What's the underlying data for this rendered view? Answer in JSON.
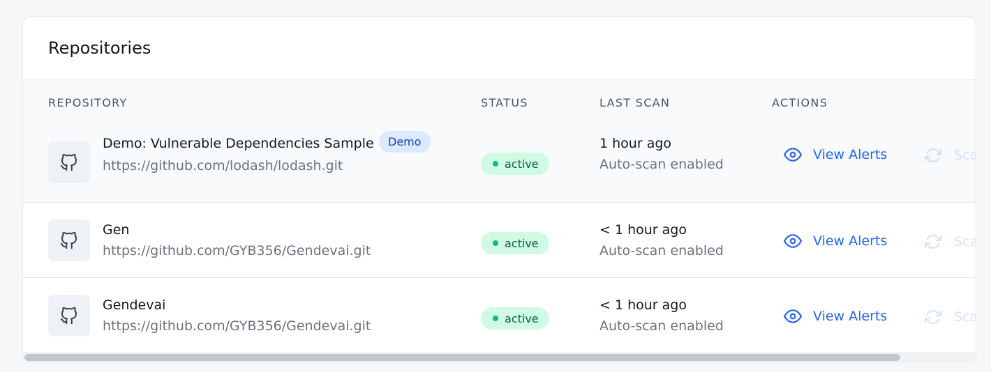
{
  "card": {
    "title": "Repositories"
  },
  "table": {
    "headers": {
      "repository": "REPOSITORY",
      "status": "STATUS",
      "last_scan": "LAST SCAN",
      "actions": "ACTIONS"
    },
    "rows": [
      {
        "name": "Demo: Vulnerable Dependencies Sample",
        "badge": "Demo",
        "url": "https://github.com/lodash/lodash.git",
        "status": "active",
        "last_scan": "1 hour ago",
        "scan_mode": "Auto-scan enabled",
        "view_alerts_label": "View Alerts",
        "scan_label": "Scan"
      },
      {
        "name": "Gen",
        "url": "https://github.com/GYB356/Gendevai.git",
        "status": "active",
        "last_scan": "< 1 hour ago",
        "scan_mode": "Auto-scan enabled",
        "view_alerts_label": "View Alerts",
        "scan_label": "Scan"
      },
      {
        "name": "Gendevai",
        "url": "https://github.com/GYB356/Gendevai.git",
        "status": "active",
        "last_scan": "< 1 hour ago",
        "scan_mode": "Auto-scan enabled",
        "view_alerts_label": "View Alerts",
        "scan_label": "Scan"
      }
    ]
  },
  "icons": {
    "repo": "github-icon",
    "view": "eye-icon",
    "scan": "refresh-icon"
  },
  "colors": {
    "accent": "#2563eb",
    "status_active_bg": "#d1fae5",
    "status_active_dot": "#10b981",
    "status_active_text": "#065f46",
    "badge_bg": "#dbeafe",
    "badge_text": "#1e40af"
  }
}
